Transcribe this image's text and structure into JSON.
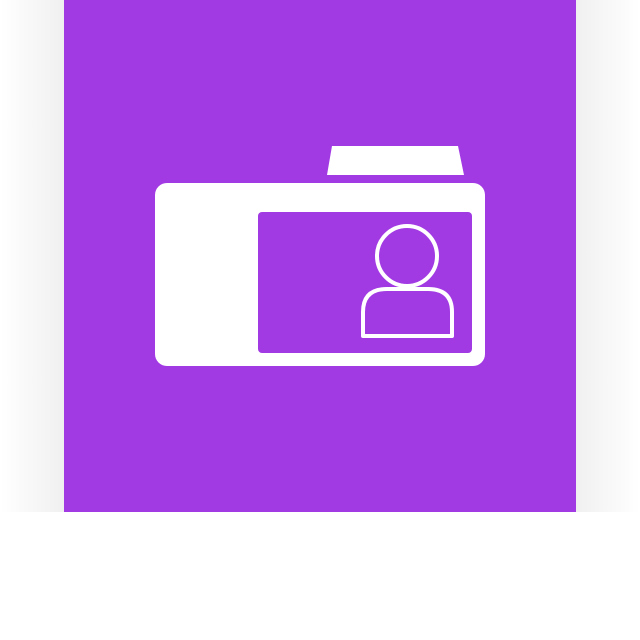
{
  "tile": {
    "background_color": "#A23AE4",
    "foreground_color": "#FFFFFF"
  },
  "icon": {
    "name": "contact-card-folder-icon"
  }
}
